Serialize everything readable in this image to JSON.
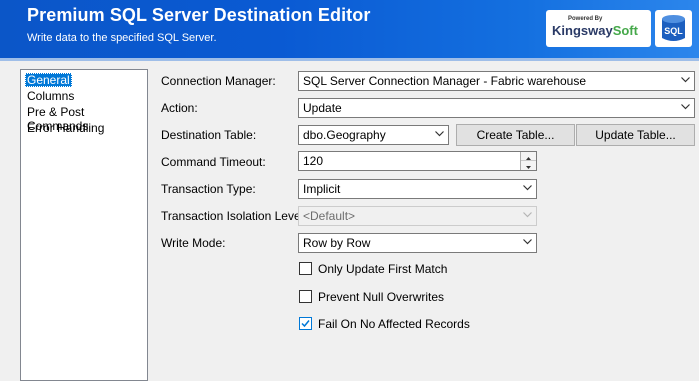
{
  "header": {
    "title": "Premium SQL Server Destination Editor",
    "subtitle": "Write data to the specified SQL Server.",
    "logo_powered": "Powered By",
    "logo_brand_main": "Kingsway",
    "logo_brand_accent": "Soft",
    "sql_icon_label": "SQL"
  },
  "nav": {
    "items": [
      {
        "label": "General",
        "selected": true
      },
      {
        "label": "Columns"
      },
      {
        "label": "Pre & Post Commands"
      },
      {
        "label": "Error Handling"
      }
    ]
  },
  "form": {
    "connection_manager": {
      "label": "Connection Manager:",
      "value": "SQL Server Connection Manager - Fabric warehouse"
    },
    "action": {
      "label": "Action:",
      "value": "Update"
    },
    "destination_table": {
      "label": "Destination Table:",
      "value": "dbo.Geography",
      "create_button": "Create Table...",
      "update_button": "Update Table..."
    },
    "command_timeout": {
      "label": "Command Timeout:",
      "value": "120"
    },
    "transaction_type": {
      "label": "Transaction Type:",
      "value": "Implicit"
    },
    "transaction_isolation_level": {
      "label": "Transaction Isolation Level:",
      "value": "<Default>"
    },
    "write_mode": {
      "label": "Write Mode:",
      "value": "Row by Row"
    },
    "only_update_first_match": {
      "label": "Only Update First Match",
      "checked": false
    },
    "prevent_null_overwrites": {
      "label": "Prevent Null Overwrites",
      "checked": false
    },
    "fail_on_no_affected_records": {
      "label": "Fail On No Affected Records",
      "checked": true
    }
  },
  "colors": {
    "header_blue": "#0b56c8",
    "selection_blue": "#0078d7",
    "brand_green": "#45a84a"
  }
}
